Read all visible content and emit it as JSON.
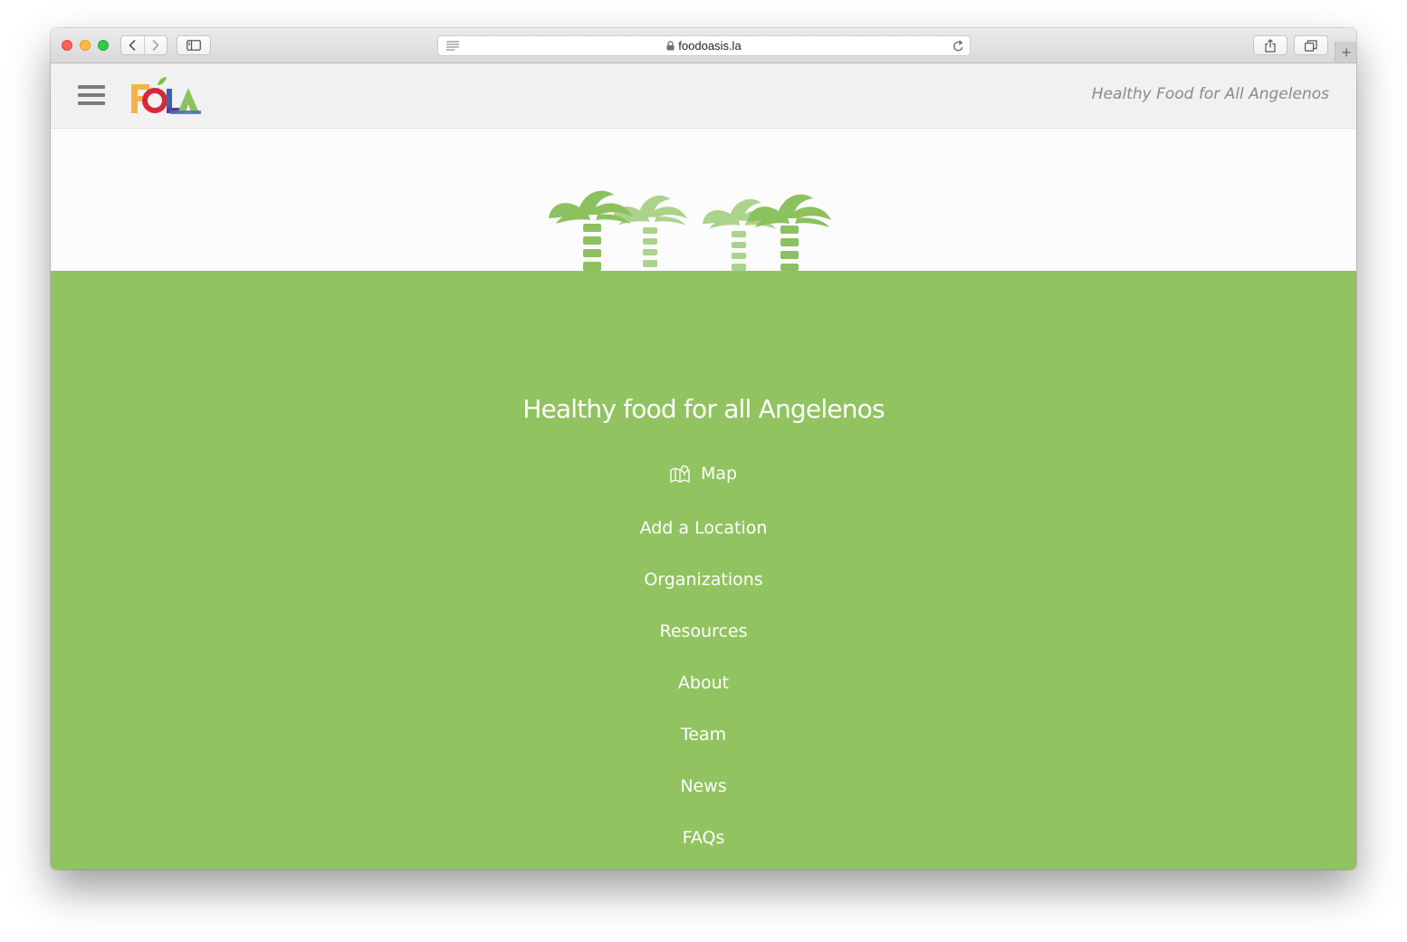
{
  "browser": {
    "url": "foodoasis.la",
    "new_tab_label": "+"
  },
  "header": {
    "logo_text": "FOLA",
    "tagline": "Healthy Food for All Angelenos"
  },
  "hero": {
    "title": "Healthy food for all Angelenos"
  },
  "menu": {
    "items": [
      {
        "label": "Map",
        "icon": "map-icon"
      },
      {
        "label": "Add a Location"
      },
      {
        "label": "Organizations"
      },
      {
        "label": "Resources"
      },
      {
        "label": "About"
      },
      {
        "label": "Team"
      },
      {
        "label": "News"
      },
      {
        "label": "FAQs"
      }
    ]
  },
  "colors": {
    "hero_green": "#91c360",
    "palm_dark": "#8cc15f",
    "palm_light": "#abd38b",
    "header_bg": "#f1f1f1",
    "tagline": "#8a8a8a"
  }
}
